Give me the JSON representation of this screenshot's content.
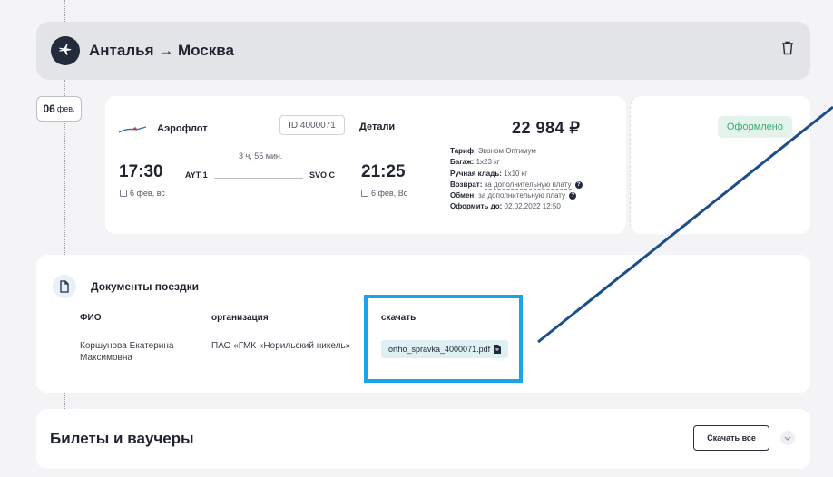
{
  "route": {
    "title": "Анталья → Москва"
  },
  "date_pill": {
    "day": "06",
    "month": "фев."
  },
  "flight": {
    "airline": "Аэрофлот",
    "id_label": "ID 4000071",
    "details_link": "Детали",
    "price": "22 984 ₽",
    "departure": {
      "time": "17:30",
      "airport": "AYT 1",
      "date": "6 фев, вс"
    },
    "duration": "3 ч, 55 мин.",
    "arrival": {
      "time": "21:25",
      "airport": "SVO C",
      "date": "6 фев, Вс"
    },
    "tariff": [
      {
        "label": "Тариф:",
        "value": "Эконом Оптимум",
        "dashed": false,
        "help": false
      },
      {
        "label": "Багаж:",
        "value": "1x23 кг",
        "dashed": false,
        "help": false
      },
      {
        "label": "Ручная кладь:",
        "value": "1x10 кг",
        "dashed": false,
        "help": false
      },
      {
        "label": "Возврат:",
        "value": "за дополнительную плату",
        "dashed": true,
        "help": true
      },
      {
        "label": "Обмен:",
        "value": "за дополнительную плату",
        "dashed": true,
        "help": true
      },
      {
        "label": "Оформить до:",
        "value": "02.02.2022 12:50",
        "dashed": false,
        "help": false
      }
    ],
    "status": "Оформлено"
  },
  "documents": {
    "title": "Документы поездки",
    "columns": {
      "fio": "ФИО",
      "org": "организация",
      "download": "скачать"
    },
    "row": {
      "fio_line1": "Коршунова Екатерина",
      "fio_line2": "Максимовна",
      "org": "ПАО «ГМК «Норильский никель»",
      "file": "ortho_spravka_4000071.pdf"
    }
  },
  "tickets": {
    "title": "Билеты и ваучеры",
    "download_all": "Скачать все"
  },
  "colors": {
    "accent_highlight": "#1aa6e6",
    "pointer_line": "#1b4f8c",
    "status_green": "#3aa876",
    "dark": "#232a3b"
  }
}
